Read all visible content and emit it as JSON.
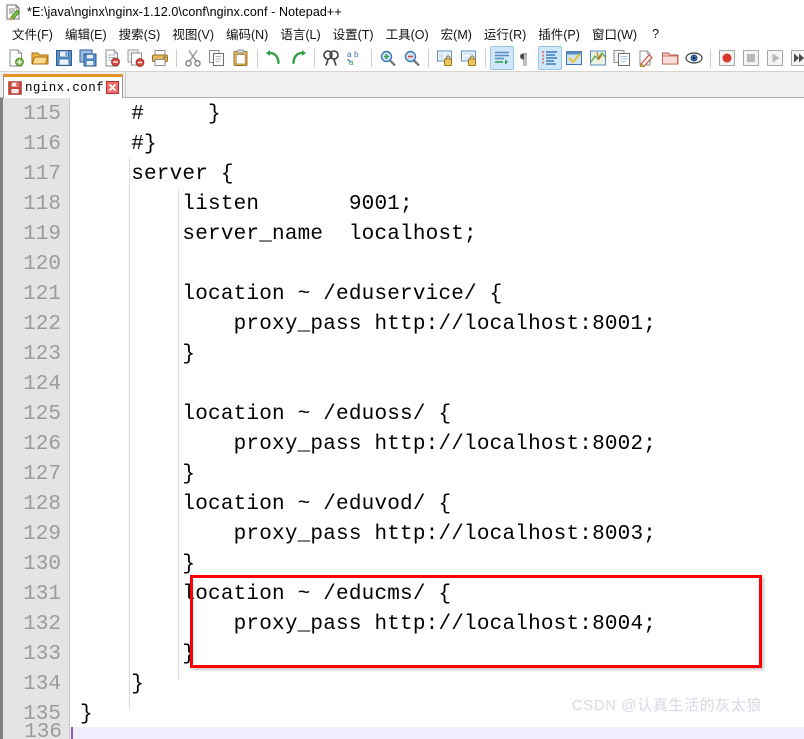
{
  "window": {
    "title": "*E:\\java\\nginx\\nginx-1.12.0\\conf\\nginx.conf - Notepad++",
    "app_icon": "notepad-plus-plus-icon"
  },
  "menubar": {
    "items": [
      {
        "label": "文件(F)",
        "name": "menu-file"
      },
      {
        "label": "编辑(E)",
        "name": "menu-edit"
      },
      {
        "label": "搜索(S)",
        "name": "menu-search"
      },
      {
        "label": "视图(V)",
        "name": "menu-view"
      },
      {
        "label": "编码(N)",
        "name": "menu-encoding"
      },
      {
        "label": "语言(L)",
        "name": "menu-language"
      },
      {
        "label": "设置(T)",
        "name": "menu-settings"
      },
      {
        "label": "工具(O)",
        "name": "menu-tools"
      },
      {
        "label": "宏(M)",
        "name": "menu-macro"
      },
      {
        "label": "运行(R)",
        "name": "menu-run"
      },
      {
        "label": "插件(P)",
        "name": "menu-plugins"
      },
      {
        "label": "窗口(W)",
        "name": "menu-window"
      },
      {
        "label": "?",
        "name": "menu-help"
      }
    ]
  },
  "toolbar": {
    "buttons": [
      {
        "icon": "new-file-icon",
        "group": 0
      },
      {
        "icon": "open-file-icon",
        "group": 0
      },
      {
        "icon": "save-icon",
        "group": 0
      },
      {
        "icon": "save-all-icon",
        "group": 0
      },
      {
        "icon": "close-file-icon",
        "group": 0
      },
      {
        "icon": "close-all-files-icon",
        "group": 0
      },
      {
        "icon": "print-icon",
        "group": 0
      },
      {
        "icon": "cut-icon",
        "group": 1
      },
      {
        "icon": "copy-icon",
        "group": 1
      },
      {
        "icon": "paste-icon",
        "group": 1
      },
      {
        "icon": "undo-icon",
        "group": 2
      },
      {
        "icon": "redo-icon",
        "group": 2
      },
      {
        "icon": "find-icon",
        "group": 3
      },
      {
        "icon": "replace-icon",
        "group": 3
      },
      {
        "icon": "zoom-in-icon",
        "group": 4
      },
      {
        "icon": "zoom-out-icon",
        "group": 4
      },
      {
        "icon": "sync-vertical-scroll-icon",
        "group": 5
      },
      {
        "icon": "sync-horizontal-scroll-icon",
        "group": 5
      },
      {
        "icon": "word-wrap-icon",
        "group": 6,
        "active": true
      },
      {
        "icon": "show-all-characters-icon",
        "group": 6
      },
      {
        "icon": "show-indent-guide-icon",
        "group": 6,
        "active": true
      },
      {
        "icon": "user-defined-dialog-icon",
        "group": 6
      },
      {
        "icon": "document-map-icon",
        "group": 6
      },
      {
        "icon": "function-list-icon",
        "group": 6
      },
      {
        "icon": "folder-as-workspace-icon",
        "group": 6
      },
      {
        "icon": "monitoring-icon",
        "group": 6
      },
      {
        "icon": "record-macro-icon",
        "group": 7
      },
      {
        "icon": "stop-recording-icon",
        "group": 7
      },
      {
        "icon": "play-macro-icon",
        "group": 7
      },
      {
        "icon": "run-macro-multiple-icon",
        "group": 7
      },
      {
        "icon": "save-macro-icon",
        "group": 7
      }
    ]
  },
  "tabs": [
    {
      "label": "nginx.conf",
      "modified": true,
      "active": true,
      "save_icon": "unsaved-floppy-icon",
      "close_icon": "close-tab-icon"
    }
  ],
  "editor": {
    "first_line_number": 115,
    "lines": [
      {
        "n": 115,
        "text": "    #     }"
      },
      {
        "n": 116,
        "text": "    #}"
      },
      {
        "n": 117,
        "text": "    server {"
      },
      {
        "n": 118,
        "text": "        listen       9001;"
      },
      {
        "n": 119,
        "text": "        server_name  localhost;"
      },
      {
        "n": 120,
        "text": ""
      },
      {
        "n": 121,
        "text": "        location ~ /eduservice/ {"
      },
      {
        "n": 122,
        "text": "            proxy_pass http://localhost:8001;"
      },
      {
        "n": 123,
        "text": "        }"
      },
      {
        "n": 124,
        "text": ""
      },
      {
        "n": 125,
        "text": "        location ~ /eduoss/ {"
      },
      {
        "n": 126,
        "text": "            proxy_pass http://localhost:8002;"
      },
      {
        "n": 127,
        "text": "        }"
      },
      {
        "n": 128,
        "text": "        location ~ /eduvod/ {"
      },
      {
        "n": 129,
        "text": "            proxy_pass http://localhost:8003;"
      },
      {
        "n": 130,
        "text": "        }"
      },
      {
        "n": 131,
        "text": "        location ~ /educms/ {"
      },
      {
        "n": 132,
        "text": "            proxy_pass http://localhost:8004;"
      },
      {
        "n": 133,
        "text": "        }"
      },
      {
        "n": 134,
        "text": "    }"
      },
      {
        "n": 135,
        "text": "}"
      }
    ],
    "partial_bottom_line": {
      "n": 136,
      "current": true
    }
  },
  "annotation": {
    "type": "red-rectangle",
    "color": "#ff0000",
    "covers_lines": [
      131,
      132,
      133
    ]
  },
  "watermark": {
    "text": "CSDN @认真生活的灰太狼",
    "color": "#d8d8e4"
  }
}
